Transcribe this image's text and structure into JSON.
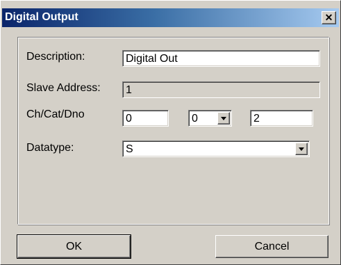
{
  "window": {
    "title": "Digital Output",
    "close_glyph": "✕"
  },
  "form": {
    "description": {
      "label": "Description:",
      "value": "Digital Out"
    },
    "slave_address": {
      "label": "Slave Address:",
      "value": "1"
    },
    "ch_cat_dno": {
      "label": "Ch/Cat/Dno",
      "ch": "0",
      "cat": "0",
      "dno": "2"
    },
    "datatype": {
      "label": "Datatype:",
      "value": "S"
    }
  },
  "buttons": {
    "ok": "OK",
    "cancel": "Cancel"
  }
}
